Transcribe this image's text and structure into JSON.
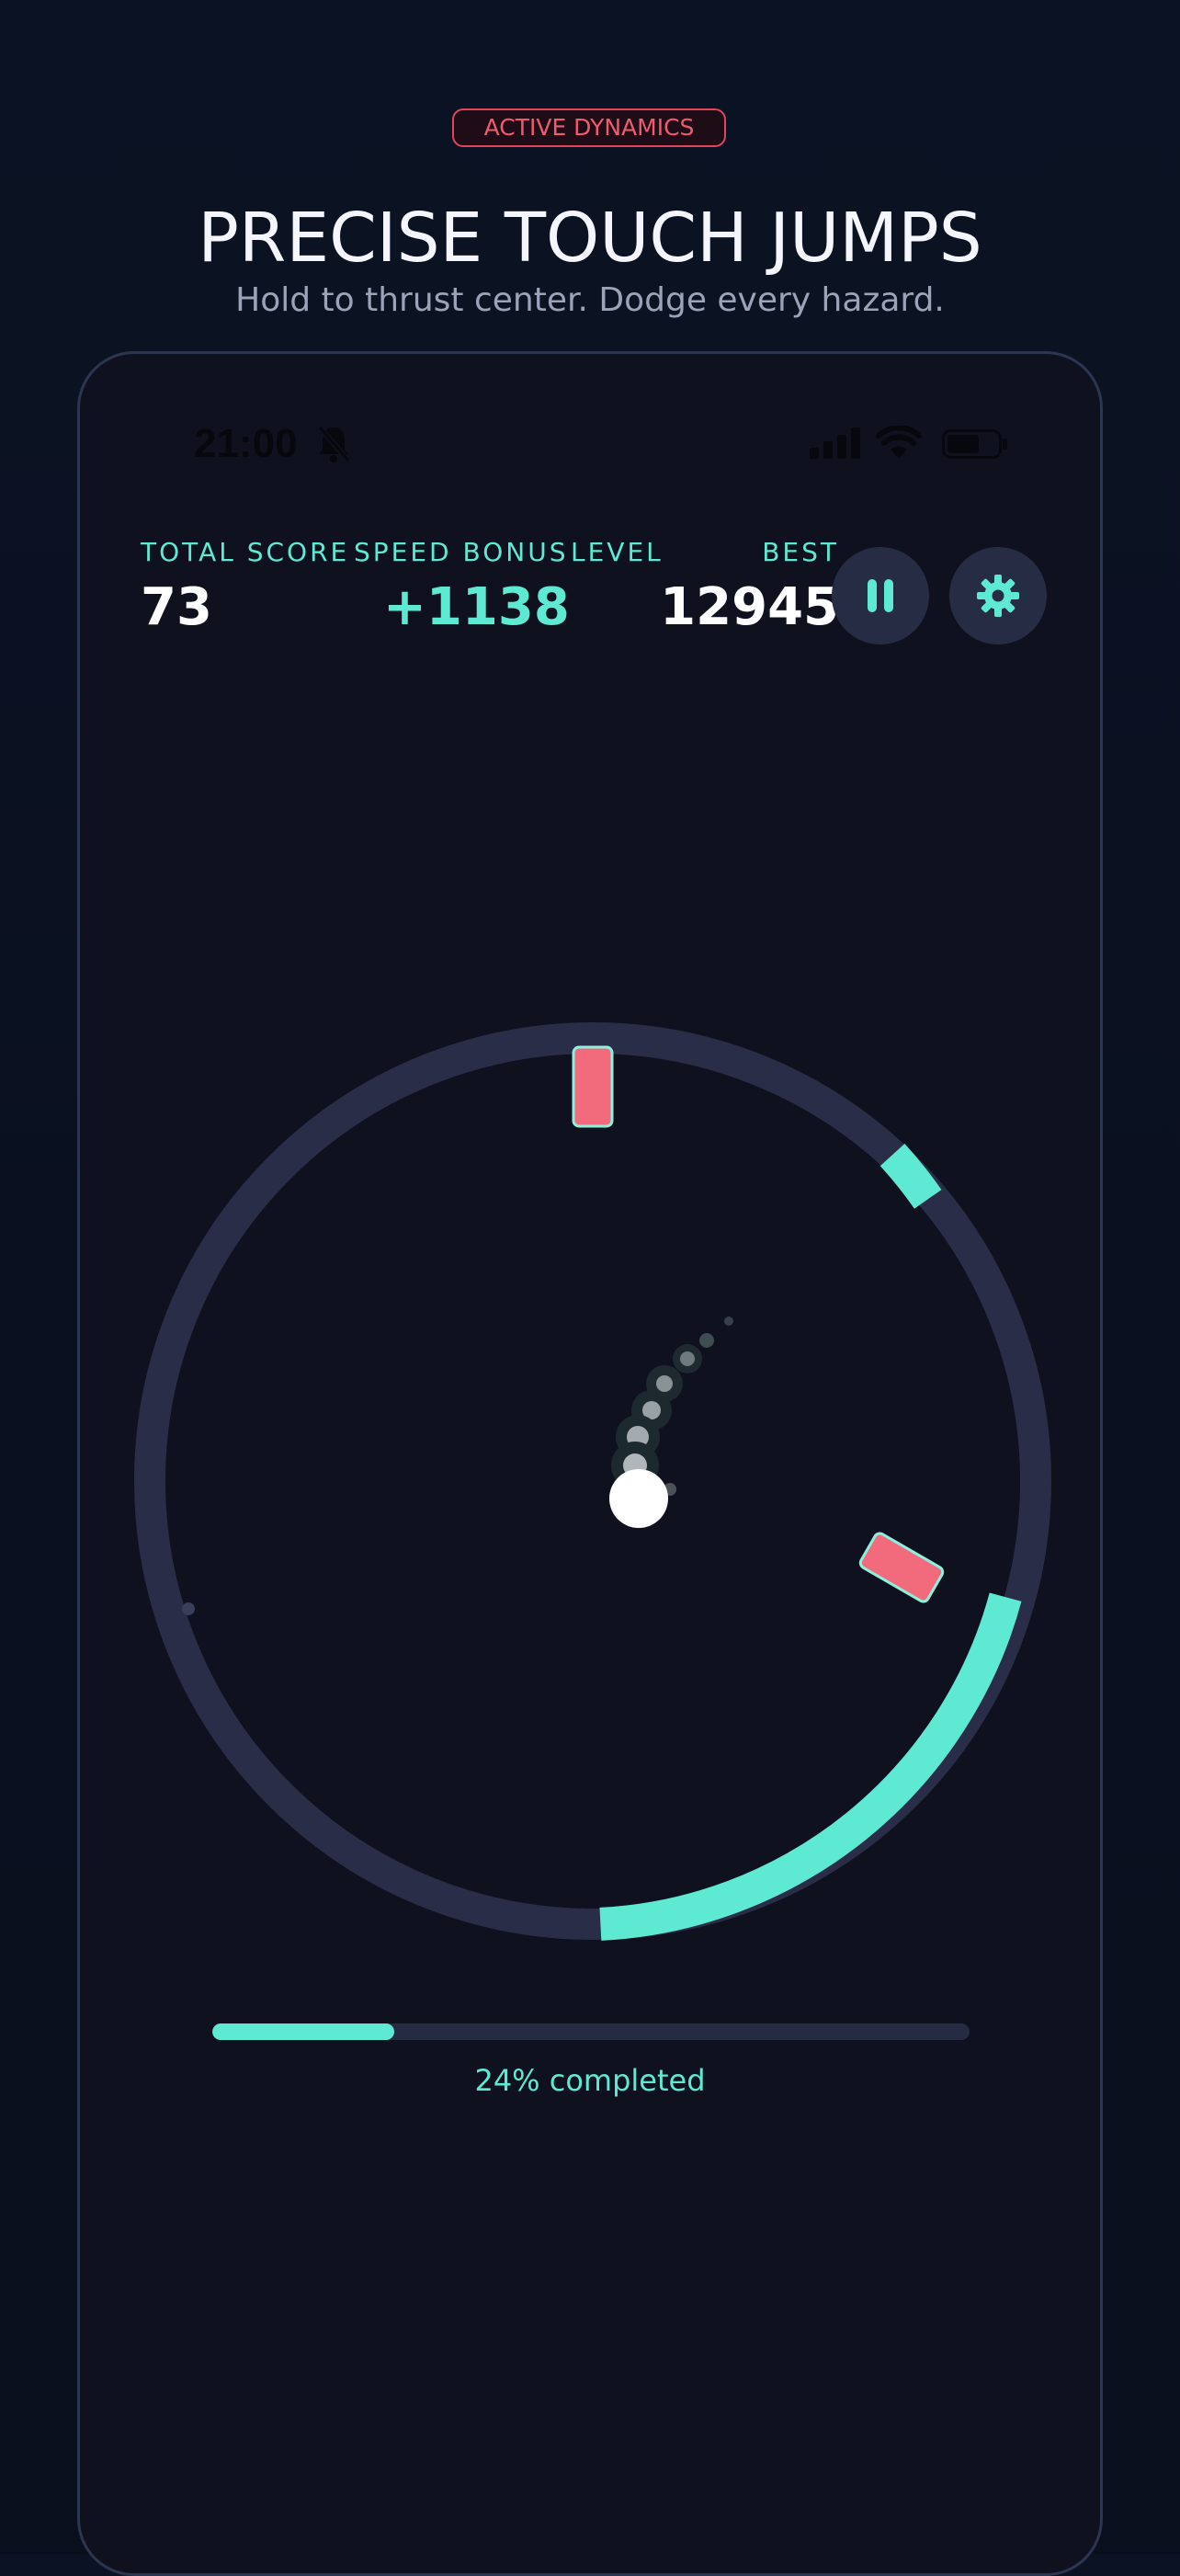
{
  "header": {
    "badge": "ACTIVE DYNAMICS",
    "title": "PRECISE TOUCH JUMPS",
    "subtitle": "Hold to thrust center. Dodge every hazard."
  },
  "status_bar": {
    "time": "21:00"
  },
  "hud": {
    "total_score_label": "TOTAL SCORE",
    "total_score_value": "73",
    "speed_bonus_label": "SPEED BONUS",
    "speed_bonus_value": "+1138",
    "level_label": "LEVEL",
    "best_label": "BEST",
    "best_value": "12945"
  },
  "controls": {
    "pause_icon": "pause-icon",
    "settings_icon": "gear-icon"
  },
  "progress": {
    "fraction": 0.24,
    "label": "24% completed"
  },
  "colors": {
    "accent": "#5ee9d2",
    "hazard": "#f26b7c",
    "ring": "#2a2d48",
    "background": "#0f111e",
    "badge": "#e0455a"
  }
}
